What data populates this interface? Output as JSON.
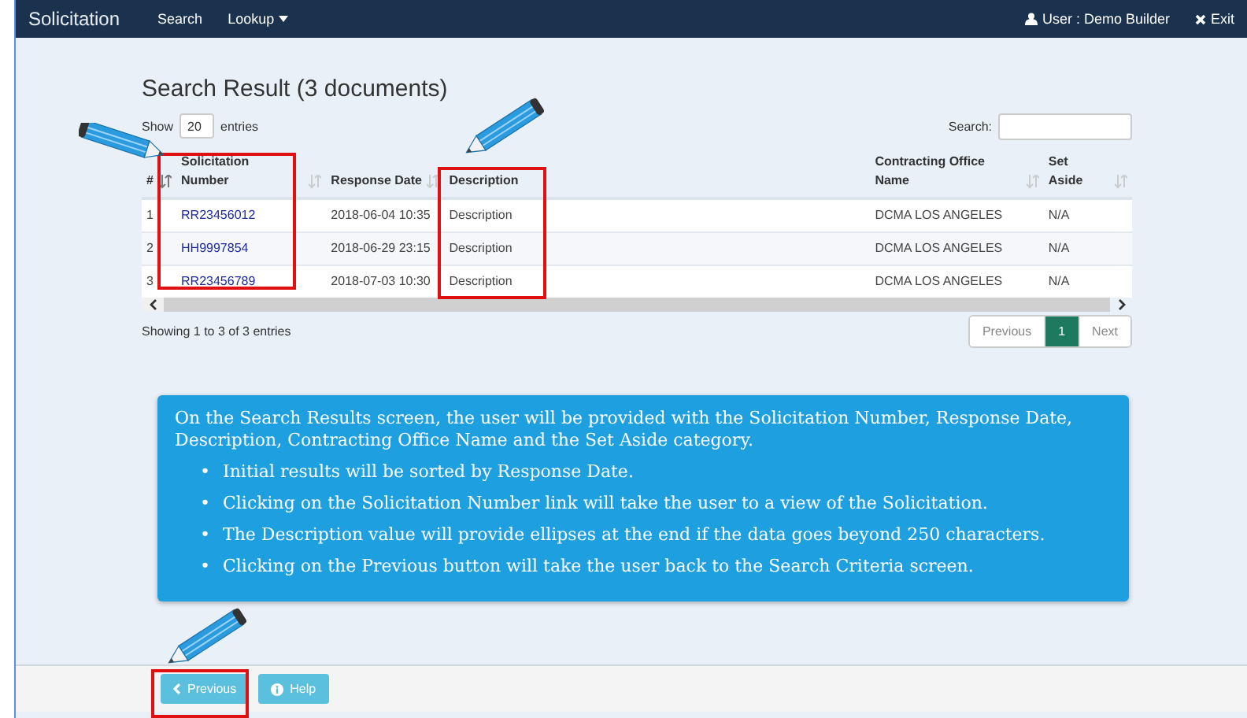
{
  "navbar": {
    "brand": "Solicitation",
    "links": [
      {
        "label": "Search",
        "caret": false
      },
      {
        "label": "Lookup",
        "caret": true
      }
    ],
    "user": "User : Demo Builder",
    "exit": "Exit"
  },
  "title": "Search Result (3 documents)",
  "length": {
    "before": "Show",
    "value": "20",
    "after": "entries"
  },
  "search": {
    "label": "Search:"
  },
  "table": {
    "columns": [
      {
        "label": "#",
        "sortable": true,
        "sorted": true
      },
      {
        "label": "Solicitation Number",
        "sortable": true,
        "sorted": false
      },
      {
        "label": "Response Date",
        "sortable": true,
        "sorted": false
      },
      {
        "label": "Description",
        "sortable": false
      },
      {
        "label": "Contracting Office Name",
        "sortable": true,
        "sorted": false
      },
      {
        "label": "Set Aside",
        "sortable": true,
        "sorted": false
      }
    ],
    "rows": [
      {
        "index": "1",
        "number": "RR23456012",
        "date": "2018-06-04 10:35",
        "description": "Description",
        "office": "DCMA LOS ANGELES",
        "set_aside": "N/A"
      },
      {
        "index": "2",
        "number": "HH9997854",
        "date": "2018-06-29 23:15",
        "description": "Description",
        "office": "DCMA LOS ANGELES",
        "set_aside": "N/A"
      },
      {
        "index": "3",
        "number": "RR23456789",
        "date": "2018-07-03 10:30",
        "description": "Description",
        "office": "DCMA LOS ANGELES",
        "set_aside": "N/A"
      }
    ]
  },
  "info": "Showing 1 to 3 of 3 entries",
  "pagination": [
    {
      "label": "Previous",
      "selected": false
    },
    {
      "label": "1",
      "selected": true
    },
    {
      "label": "Next",
      "selected": false
    }
  ],
  "callout": {
    "marker": "•",
    "intro": "On the Search Results screen, the user will be provided with the Solicitation Number, Response Date, Description, Contracting Office Name and the Set Aside category.",
    "bullets": [
      "Initial results will be sorted by Response Date.",
      "Clicking on the Solicitation Number link will take the user to a view of the Solicitation.",
      "The Description value will provide ellipses at the end if the data goes beyond 250 characters.",
      "Clicking on the Previous button will take the user back to the Search Criteria screen."
    ]
  },
  "footer_buttons": [
    {
      "label": "Previous",
      "kind": "back"
    },
    {
      "label": "Help",
      "kind": "help"
    }
  ]
}
